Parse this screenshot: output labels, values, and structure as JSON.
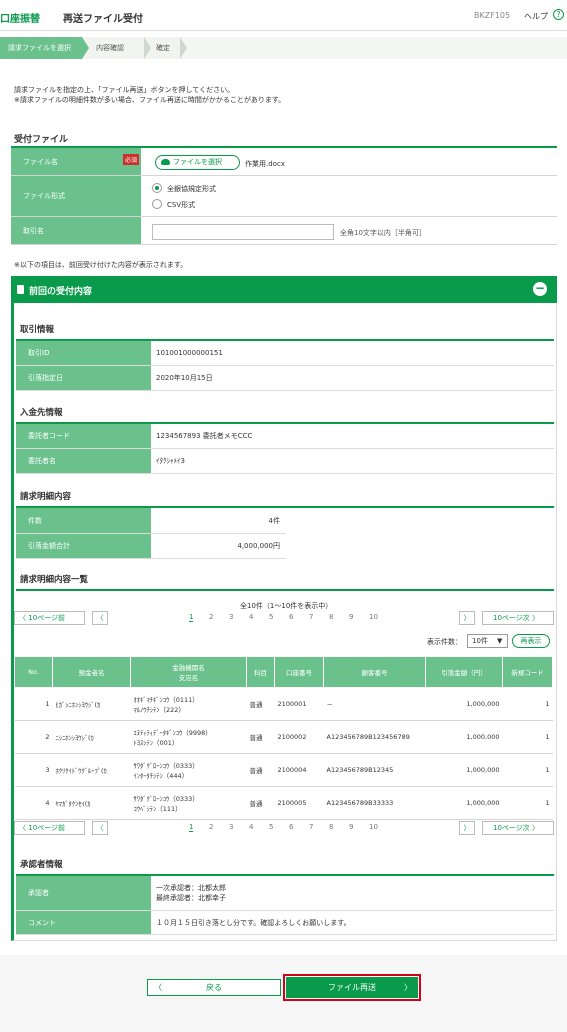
{
  "header": {
    "app_label": "口座振替",
    "page_title": "再送ファイル受付",
    "screen_code": "BKZF105",
    "help_label": "ヘルプ",
    "help_icon": "?"
  },
  "steps": [
    "請求ファイルを選択",
    "内容確認",
    "確定"
  ],
  "intro": [
    "請求ファイルを指定の上、「ファイル再送」ボタンを押してください。",
    "※請求ファイルの明細件数が多い場合、ファイル再送に時間がかかることがあります。"
  ],
  "upload": {
    "section_title": "受付ファイル",
    "file_name_label": "ファイル名",
    "required_badge": "必須",
    "choose_file_label": "ファイルを選択",
    "selected_file": "作業用.docx",
    "format_label": "ファイル形式",
    "format_options": [
      "全銀協規定形式",
      "CSV形式"
    ],
    "format_selected": "全銀協規定形式",
    "name_label": "取引名",
    "name_value": "",
    "name_hint": "全角10文字以内［半角可］"
  },
  "note": "※以下の項目は、前回受け付けた内容が表示されます。",
  "previous": {
    "panel_title": "前回の受付内容",
    "trans": {
      "title": "取引情報",
      "id_label": "取引ID",
      "id_value": "101001000000151",
      "date_label": "引落指定日",
      "date_value": "2020年10月15日"
    },
    "payee": {
      "title": "入金先情報",
      "code_label": "委託者コード",
      "code_value": "1234567893 委託者メモCCC",
      "name_label": "委託者名",
      "name_value": "ｲﾀｸｼｬﾒｲ3"
    },
    "summary": {
      "title": "請求明細内容",
      "count_label": "件数",
      "count_value": "4件",
      "total_label": "引落金額合計",
      "total_value": "4,000,000円"
    },
    "list": {
      "title": "請求明細内容一覧",
      "count_text": "全10件（1〜10件を表示中）",
      "prev10": "10ページ前",
      "next10": "10ページ次",
      "pages": [
        "1",
        "2",
        "3",
        "4",
        "5",
        "6",
        "7",
        "8",
        "9",
        "10"
      ],
      "current_page": "1",
      "per_page_label": "表示件数：",
      "per_page_value": "10件",
      "redisplay_label": "再表示",
      "columns": [
        "No.",
        "預金者名",
        "金融機関名\n支店名",
        "科目",
        "口座番号",
        "顧客番号",
        "引落金額（円）",
        "新規コード"
      ],
      "rows": [
        {
          "no": "1",
          "depositor": "ﾋｶﾞｼﾆﾎﾝｼﾖｳｼﾞ(ｶ",
          "bank": "ｵｵｷﾞﾏﾁｷﾞﾝｺｳ（0111）",
          "branch": "ﾏﾙﾉｳﾁｼﾃﾝ（222）",
          "type": "普通",
          "account": "2100001",
          "customer": "－",
          "amount": "1,000,000",
          "code": "1"
        },
        {
          "no": "2",
          "depositor": "ﾆｼﾆﾎﾝｼﾖｳｼﾞ(ｶ",
          "bank": "ｴﾇﾃｨﾃｨﾃﾞｰﾀｷﾞﾝｺｳ（9998）",
          "branch": "ﾄﾖｽｼﾃﾝ（001）",
          "type": "普通",
          "account": "2100002",
          "customer": "A123456789B123456789",
          "amount": "1,000,000",
          "code": "1"
        },
        {
          "no": "3",
          "depositor": "ﾎｸﾘｸｲﾄﾞｳｸﾞﾙｰﾌﾟ(ｶ",
          "bank": "ｻﾜﾀﾞｸﾞﾛｰﾝｺｳ（0333）",
          "branch": "ｲﾝﾀｰﾀﾁｼﾃﾝ（444）",
          "type": "普通",
          "account": "2100004",
          "customer": "A123456789B12345",
          "amount": "1,000,000",
          "code": "1"
        },
        {
          "no": "4",
          "depositor": "ﾔﾏｶﾞﾀｸﾝｾｲ(ｶ",
          "bank": "ｻﾜﾀﾞｸﾞﾛｰﾝｺｳ（0333）",
          "branch": "ｺｳﾍﾞｼﾃﾝ（111）",
          "type": "普通",
          "account": "2100005",
          "customer": "A123456789B33333",
          "amount": "1,000,000",
          "code": "1"
        }
      ]
    },
    "approver": {
      "title": "承認者情報",
      "approver_label": "承認者",
      "first": "一次承認者：北都太郎",
      "final": "最終承認者：北都幸子",
      "comment_label": "コメント",
      "comment_value": "１０月１５日引き落とし分です。確認よろしくお願いします。"
    }
  },
  "actions": {
    "back_label": "戻る",
    "resend_label": "ファイル再送"
  }
}
